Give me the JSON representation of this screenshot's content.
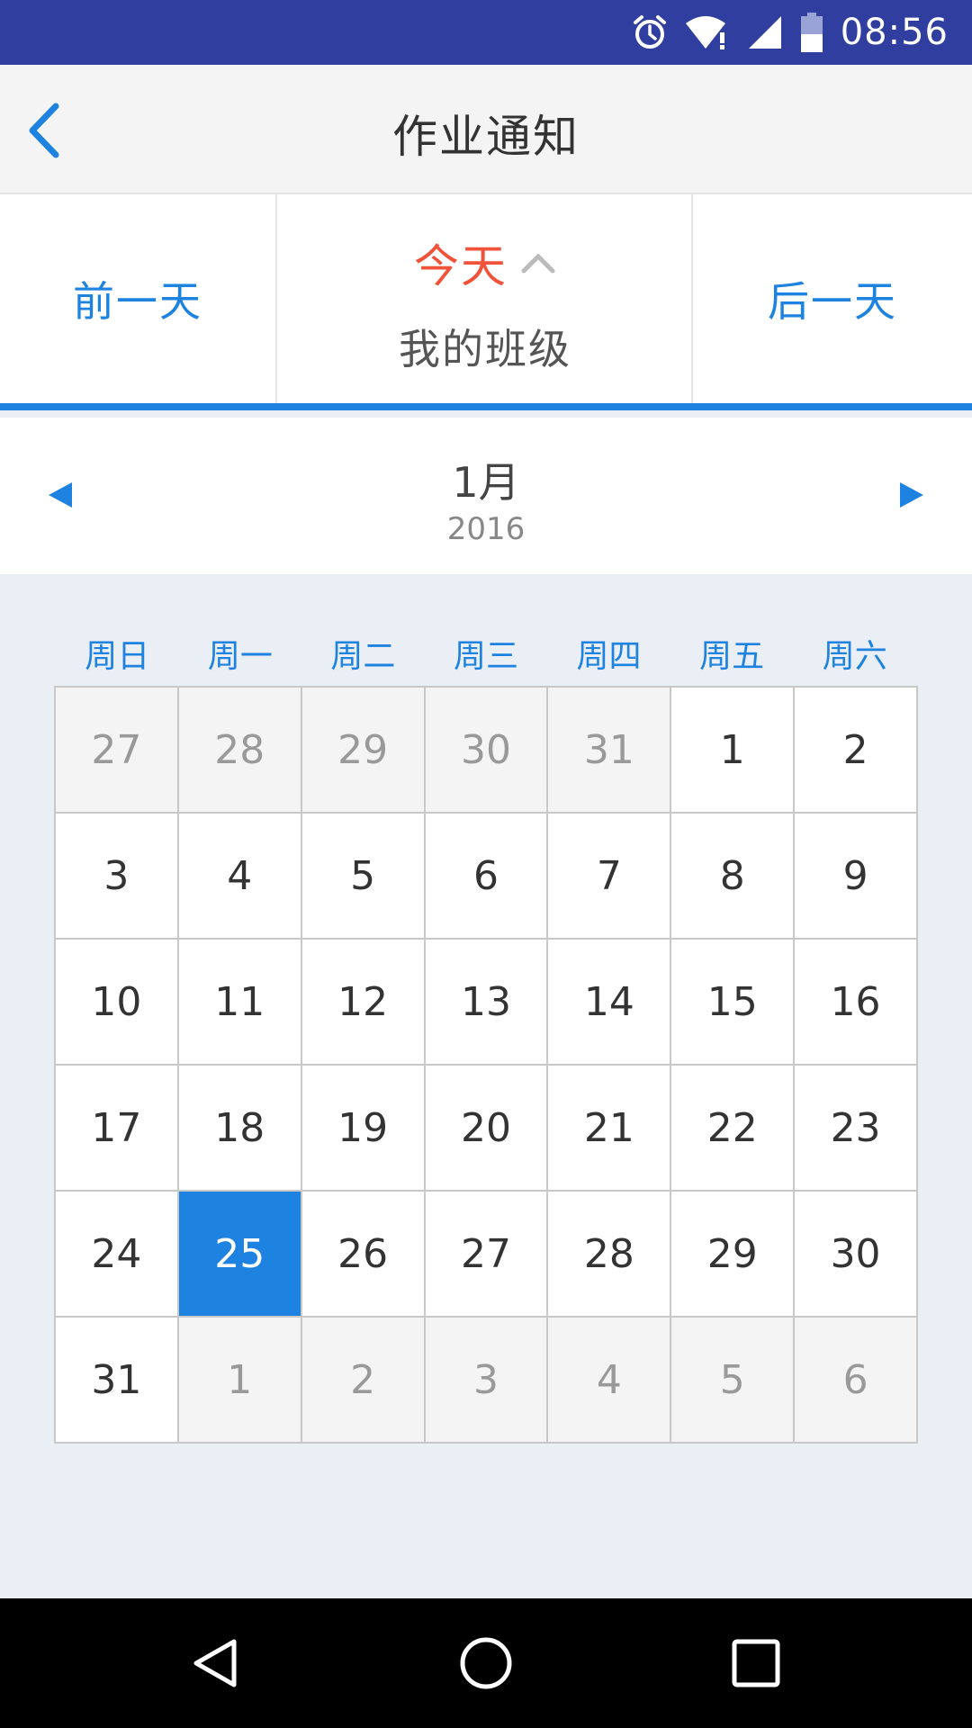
{
  "status_bar": {
    "time": "08:56",
    "icons": [
      "alarm-icon",
      "wifi-icon",
      "signal-icon",
      "battery-icon"
    ]
  },
  "header": {
    "title": "作业通知",
    "back_icon": "chevron-left-icon"
  },
  "day_switcher": {
    "prev_label": "前一天",
    "today_label": "今天",
    "class_label": "我的班级",
    "next_label": "后一天",
    "expand_icon": "chevron-up-icon"
  },
  "month_header": {
    "month": "1月",
    "year": "2016",
    "prev_icon": "triangle-left-icon",
    "next_icon": "triangle-right-icon"
  },
  "weekdays": [
    "周日",
    "周一",
    "周二",
    "周三",
    "周四",
    "周五",
    "周六"
  ],
  "calendar": {
    "days": [
      {
        "label": "27",
        "other": true
      },
      {
        "label": "28",
        "other": true
      },
      {
        "label": "29",
        "other": true
      },
      {
        "label": "30",
        "other": true
      },
      {
        "label": "31",
        "other": true
      },
      {
        "label": "1"
      },
      {
        "label": "2"
      },
      {
        "label": "3"
      },
      {
        "label": "4"
      },
      {
        "label": "5"
      },
      {
        "label": "6"
      },
      {
        "label": "7"
      },
      {
        "label": "8"
      },
      {
        "label": "9"
      },
      {
        "label": "10"
      },
      {
        "label": "11"
      },
      {
        "label": "12"
      },
      {
        "label": "13"
      },
      {
        "label": "14"
      },
      {
        "label": "15"
      },
      {
        "label": "16"
      },
      {
        "label": "17"
      },
      {
        "label": "18"
      },
      {
        "label": "19"
      },
      {
        "label": "20"
      },
      {
        "label": "21"
      },
      {
        "label": "22"
      },
      {
        "label": "23"
      },
      {
        "label": "24"
      },
      {
        "label": "25",
        "selected": true
      },
      {
        "label": "26"
      },
      {
        "label": "27"
      },
      {
        "label": "28"
      },
      {
        "label": "29"
      },
      {
        "label": "30"
      },
      {
        "label": "31"
      },
      {
        "label": "1",
        "other": true
      },
      {
        "label": "2",
        "other": true
      },
      {
        "label": "3",
        "other": true
      },
      {
        "label": "4",
        "other": true
      },
      {
        "label": "5",
        "other": true
      },
      {
        "label": "6",
        "other": true
      }
    ]
  },
  "nav_bar": {
    "icons": [
      "back-triangle-icon",
      "home-circle-icon",
      "recents-square-icon"
    ]
  },
  "colors": {
    "accent": "#1e82e0",
    "today": "#f0533a",
    "status_bar": "#303f9f",
    "background": "#eaeef5"
  }
}
